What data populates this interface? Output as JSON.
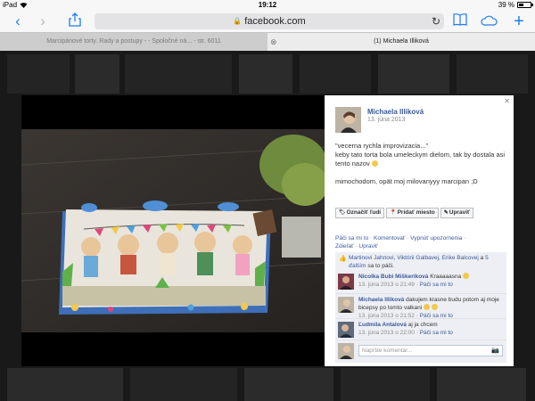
{
  "status_bar": {
    "device": "iPad",
    "time": "19:12",
    "battery": "39 %"
  },
  "browser": {
    "url": "facebook.com",
    "tabs": [
      {
        "label": "Marcipánové torty. Rady a postupy - - Spoločné ná... - str. 6011"
      },
      {
        "label": "(1) Michaela Illiková"
      }
    ]
  },
  "post": {
    "author": "Michaela Illiková",
    "date": "13. júna 2013",
    "caption_line1": "\"vecerna rychla improvizacia...\"",
    "caption_line2": "keby tato torta bola umeleckym dielom, tak by dostala asi tento nazov",
    "caption_line3": "mimochodom, opät moj milovanyyy marcipan ;D",
    "actions": [
      {
        "label": "Označiť ľudí",
        "icon": "tag-icon"
      },
      {
        "label": "Pridať miesto",
        "icon": "location-pin-icon"
      },
      {
        "label": "Upraviť",
        "icon": "pencil-icon"
      }
    ],
    "links": {
      "like": "Páči sa mi to",
      "sep": " · ",
      "comment": "Komentovať",
      "unfollow": "Vypnúť upozornenia",
      "share": "Zdieľať",
      "edit": "Upraviť"
    },
    "likes": {
      "names": "Martinovi Jahnovi, Viktórii Galbavej, Erike Balcovej",
      "conj": " a ",
      "others": "5 ďalším",
      "suffix": " sa to páči."
    },
    "comments": [
      {
        "author": "Nicolka Bubi Miškeríková",
        "text": " Kraaaaasna ",
        "date": "13. júna 2013 o 21:49",
        "like": "Páči sa mi to"
      },
      {
        "author": "Michaela Illiková",
        "text": " dakujem  krasne budu potom aj moje bicepsy po tomto valkani  ",
        "date": "13. júna 2013 o 21:52",
        "like": "Páči sa mi to"
      },
      {
        "author": "Ľudmila Antalová",
        "text": " aj ja chcem",
        "date": "13. júna 2013 o 22:00",
        "like": "Páči sa mi to"
      }
    ],
    "comment_placeholder": "Napíšte komentár..."
  },
  "colors": {
    "fb_blue": "#3b5998",
    "ios_blue": "#1e7cf2",
    "overlay": "#191919"
  }
}
